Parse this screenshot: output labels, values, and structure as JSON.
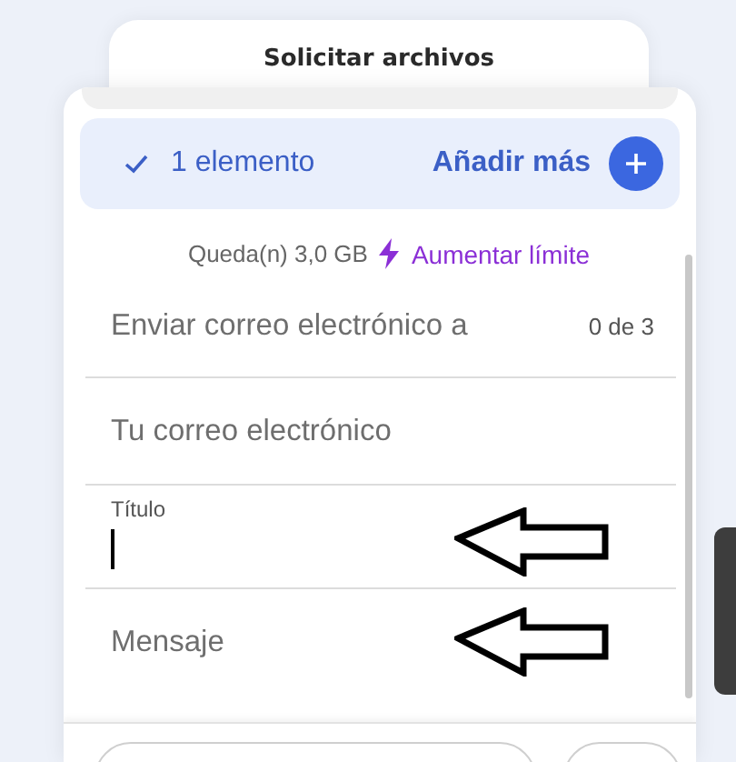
{
  "dialog": {
    "title": "Solicitar archivos",
    "selection": {
      "checked": true,
      "label": "1 elemento",
      "add_button": "Añadir más"
    },
    "quota": {
      "text": "Queda(n) 3,0 GB",
      "upgrade_link": "Aumentar límite"
    },
    "fields": [
      {
        "kind": "recipients",
        "placeholder": "Enviar correo electrónico a",
        "counter": "0 de 3",
        "arrow_marked": false
      },
      {
        "kind": "plain",
        "placeholder": "Tu correo electrónico",
        "arrow_marked": false
      },
      {
        "kind": "floating",
        "label": "Título",
        "focused": true,
        "arrow_marked": true
      },
      {
        "kind": "plain",
        "placeholder": "Mensaje",
        "arrow_marked": true
      }
    ]
  }
}
